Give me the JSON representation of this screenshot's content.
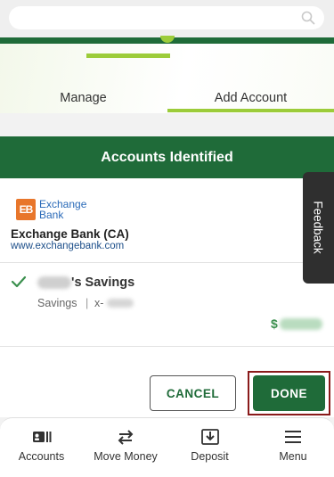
{
  "search": {
    "placeholder": "",
    "value": ""
  },
  "tabs": [
    {
      "label": "Manage",
      "active": false
    },
    {
      "label": "Add Account",
      "active": true
    }
  ],
  "section": {
    "title": "Accounts Identified"
  },
  "institution": {
    "logo_mark": "EB",
    "logo_line1": "Exchange",
    "logo_line2": "Bank",
    "name": "Exchange Bank (CA)",
    "url": "www.exchangebank.com"
  },
  "account": {
    "selected": true,
    "name_suffix": "'s Savings",
    "type": "Savings",
    "separator": "|",
    "mask_prefix": "x-",
    "balance_symbol": "$"
  },
  "actions": {
    "cancel_label": "CANCEL",
    "done_label": "DONE"
  },
  "feedback": {
    "label": "Feedback"
  },
  "nav": {
    "items": [
      {
        "label": "Accounts",
        "icon": "accounts-icon"
      },
      {
        "label": "Move Money",
        "icon": "transfer-arrows-icon",
        "active": true
      },
      {
        "label": "Deposit",
        "icon": "deposit-icon"
      },
      {
        "label": "Menu",
        "icon": "hamburger-menu-icon"
      }
    ]
  },
  "colors": {
    "brand_green": "#1f6b39",
    "accent_lime": "#9ccc3a",
    "highlight_border": "#8a1a1a",
    "feedback_bg": "#2f2f2f"
  }
}
